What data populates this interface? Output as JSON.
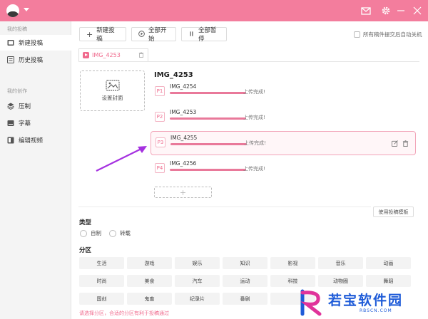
{
  "colors": {
    "accent": "#f37d9d",
    "pink_text": "#f06a8d",
    "bar": "#e9799a",
    "arrow": "#a531e0",
    "watermark": "#1e5bd8"
  },
  "sidebar": {
    "section1": "我的投稿",
    "items1": [
      {
        "label": "新建投稿",
        "icon": "film-icon",
        "active": true
      },
      {
        "label": "历史投稿",
        "icon": "history-icon",
        "active": false
      }
    ],
    "section2": "我的创作",
    "items2": [
      {
        "label": "压制",
        "icon": "layers-icon"
      },
      {
        "label": "字幕",
        "icon": "subtitle-icon"
      },
      {
        "label": "编辑视频",
        "icon": "edit-video-icon"
      }
    ]
  },
  "toolbar": {
    "new_upload": "新建投稿",
    "start_all": "全部开始",
    "pause_all": "全部暂停",
    "auto_shutdown": "所有稿件提交后自动关机"
  },
  "file_tab": {
    "name": "IMG_4253"
  },
  "cover": {
    "label": "设置封面"
  },
  "video": {
    "title": "IMG_4253"
  },
  "parts": [
    {
      "badge": "P1",
      "name": "IMG_4254",
      "status": "上传完成!",
      "progress": 1.0
    },
    {
      "badge": "P2",
      "name": "IMG_4253",
      "status": "上传完成!",
      "progress": 1.0
    },
    {
      "badge": "P3",
      "name": "IMG_4255",
      "status": "上传完成!",
      "progress": 1.0
    },
    {
      "badge": "P4",
      "name": "IMG_4256",
      "status": "上传完成!",
      "progress": 1.0
    }
  ],
  "add_part": "+",
  "template_button": "使用投稿模板",
  "type_section": {
    "title": "类型",
    "options": [
      "自制",
      "转载"
    ]
  },
  "category_section": {
    "title": "分区",
    "rows": [
      [
        "生活",
        "游戏",
        "娱乐",
        "知识",
        "影视",
        "音乐",
        "动画"
      ],
      [
        "时尚",
        "美食",
        "汽车",
        "运动",
        "科技",
        "动物圈",
        "舞蹈"
      ],
      [
        "国创",
        "鬼畜",
        "纪录片",
        "番剧",
        "",
        "",
        ""
      ]
    ]
  },
  "hint": "请选择分区，合适的分区有利于投稿通过",
  "watermark": {
    "text": "若宝软件园",
    "sub": "RBSCN.COM"
  }
}
